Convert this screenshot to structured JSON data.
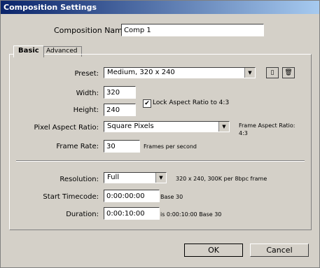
{
  "window": {
    "title": "Composition Settings"
  },
  "composition_name": {
    "label": "Composition Name:",
    "value": "Comp 1"
  },
  "tabs": [
    {
      "label": "Basic",
      "active": true
    },
    {
      "label": "Advanced",
      "active": false
    }
  ],
  "preset": {
    "label": "Preset:",
    "value": "Medium, 320 x 240"
  },
  "width": {
    "label": "Width:",
    "value": "320"
  },
  "height": {
    "label": "Height:",
    "value": "240"
  },
  "lock_aspect": {
    "label": "Lock Aspect Ratio to 4:3",
    "checked": true
  },
  "pixel_aspect": {
    "label": "Pixel Aspect Ratio:",
    "value": "Square Pixels"
  },
  "frame_aspect": {
    "label": "Frame Aspect Ratio:",
    "value": "4:3"
  },
  "frame_rate": {
    "label": "Frame Rate:",
    "value": "30",
    "unit": "Frames per second"
  },
  "resolution": {
    "label": "Resolution:",
    "value": "Full",
    "info": "320 x 240, 300K per 8bpc frame"
  },
  "start_timecode": {
    "label": "Start Timecode:",
    "value": "0:00:00:00",
    "base": "Base 30"
  },
  "duration": {
    "label": "Duration:",
    "value": "0:00:10:00",
    "info": "is 0:00:10:00  Base 30"
  },
  "buttons": {
    "ok": "OK",
    "cancel": "Cancel"
  }
}
